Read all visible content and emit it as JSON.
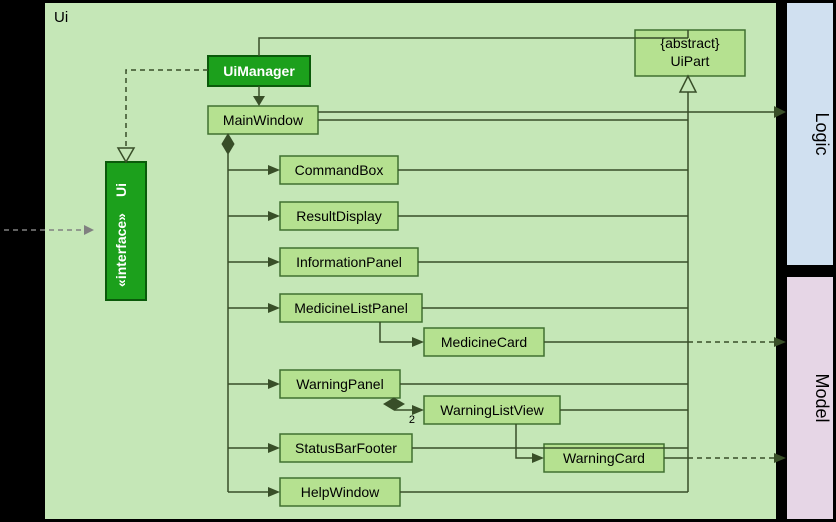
{
  "package": {
    "ui_label": "Ui"
  },
  "side": {
    "logic": "Logic",
    "model": "Model"
  },
  "ui": {
    "interface_stereo": "«interface»",
    "interface_name": "Ui",
    "manager": "UiManager",
    "mainwindow": "MainWindow",
    "commandbox": "CommandBox",
    "resultdisplay": "ResultDisplay",
    "infopanel": "InformationPanel",
    "medlistpanel": "MedicineListPanel",
    "medcard": "MedicineCard",
    "warnpanel": "WarningPanel",
    "warnlistview": "WarningListView",
    "statusbar": "StatusBarFooter",
    "warncard": "WarningCard",
    "helpwindow": "HelpWindow",
    "abstract_stereo": "{abstract}",
    "uipart": "UiPart"
  },
  "mult": {
    "two": "2"
  }
}
